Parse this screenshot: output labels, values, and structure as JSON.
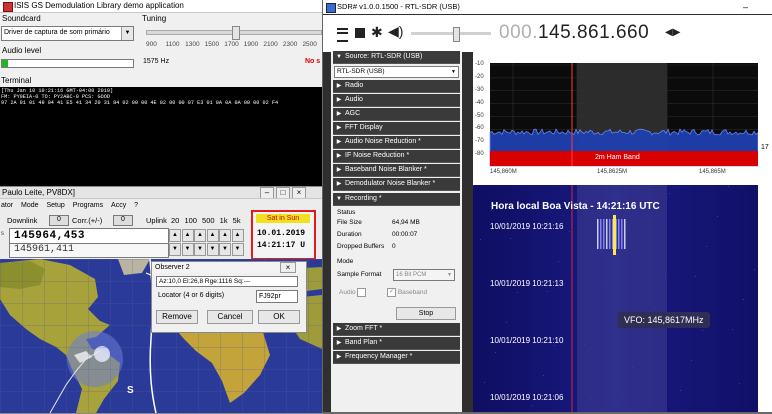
{
  "isis": {
    "title": "ISIS GS Demodulation Library demo application",
    "soundcard_label": "Soundcard",
    "soundcard_value": "Driver de captura de som primário",
    "audio_level_label": "Audio level",
    "tuning_label": "Tuning",
    "tuning_ticks": [
      "900",
      "1100",
      "1300",
      "1500",
      "1700",
      "1900",
      "2100",
      "2300",
      "2500"
    ],
    "tuning_value": "1575 Hz",
    "no_signal": "No s",
    "terminal_label": "Terminal",
    "terminal_lines": [
      "[Thu Jan 10 10:21:16 GMT-04:00 2019]",
      "FM: PY0EIA-0    TO: PY2ABC-0     PCS: GOOD",
      "97 2A 01 01 49 04 41 E5 41 34 20 31 84 02 00 00 4E 02 00 00 07 E3 01 0A 0A 0A 00 00 02 F4"
    ]
  },
  "tracker": {
    "title": "Paulo Leite, PV8DX]",
    "menu": [
      "ator",
      "Mode",
      "Setup",
      "Programs",
      "Accy",
      "?"
    ],
    "downlink_label": "Downlink",
    "downlink_value": "0",
    "corr_label": "Corr.(+/-)",
    "corr_value": "0",
    "uplink_label": "Uplink",
    "steps": [
      "20",
      "100",
      "500",
      "1k",
      "5k"
    ],
    "freq_main": "145964,453",
    "freq_sub": "145961,411",
    "sat_status": "Sat in Sun",
    "date": "10.01.2019",
    "time": "14:21:17 U",
    "map_marker": "S"
  },
  "observer": {
    "title": "Observer 2",
    "info": "Az:10,0  El:26,8  Rge:1116  Sq:---",
    "locator_label": "Locator (4 or 6 digits)",
    "locator_value": "FJ92pr",
    "remove": "Remove",
    "cancel": "Cancel",
    "ok": "OK"
  },
  "sdr": {
    "title": "SDR# v1.0.0.1500 - RTL-SDR (USB)",
    "frequency_dim": "000.",
    "frequency": "145.861.660",
    "source_header": "Source: RTL-SDR (USB)",
    "source_value": "RTL-SDR (USB)",
    "panels_top": [
      "Radio",
      "Audio",
      "AGC",
      "FFT Display",
      "Audio Noise Reduction *",
      "IF Noise Reduction *",
      "Baseband Noise Blanker *",
      "Demodulator Noise Blanker *"
    ],
    "recording_header": "Recording *",
    "status_label": "Status",
    "file_size_label": "File Size",
    "file_size_value": "64,94 MB",
    "duration_label": "Duration",
    "duration_value": "00:00:07",
    "dropped_label": "Dropped Buffers",
    "dropped_value": "0",
    "mode_label": "Mode",
    "sample_format_label": "Sample Format",
    "sample_format_value": "16 Bit PCM",
    "audio_check": "Audio",
    "baseband_check": "Baseband",
    "stop_label": "Stop",
    "panels_bottom": [
      "Zoom FFT *",
      "Band Plan *",
      "Frequency Manager *"
    ],
    "fft_db_ticks": [
      "-10",
      "-20",
      "-30",
      "-40",
      "-50",
      "-60",
      "-70",
      "-80"
    ],
    "fft_freq_ticks": [
      "145,860M",
      "145,8625M",
      "145,865M"
    ],
    "band_label": "2m Ham Band",
    "side_value": "17",
    "waterfall_title": "Hora local Boa Vista  - 14:21:16 UTC",
    "waterfall_times": [
      "10/01/2019 10:21:16",
      "10/01/2019 10:21:13",
      "10/01/2019 10:21:10",
      "10/01/2019 10:21:06"
    ],
    "vfo_label": "VFO: 145,8617MHz"
  },
  "colors": {
    "red_box": "#e21b1b",
    "sat_status_bg": "#f0e020",
    "band_red": "#d80000",
    "waterfall_bg": "#14146e",
    "fft_bg": "#0b0b0b",
    "sdr_dark": "#2f2f2f"
  }
}
